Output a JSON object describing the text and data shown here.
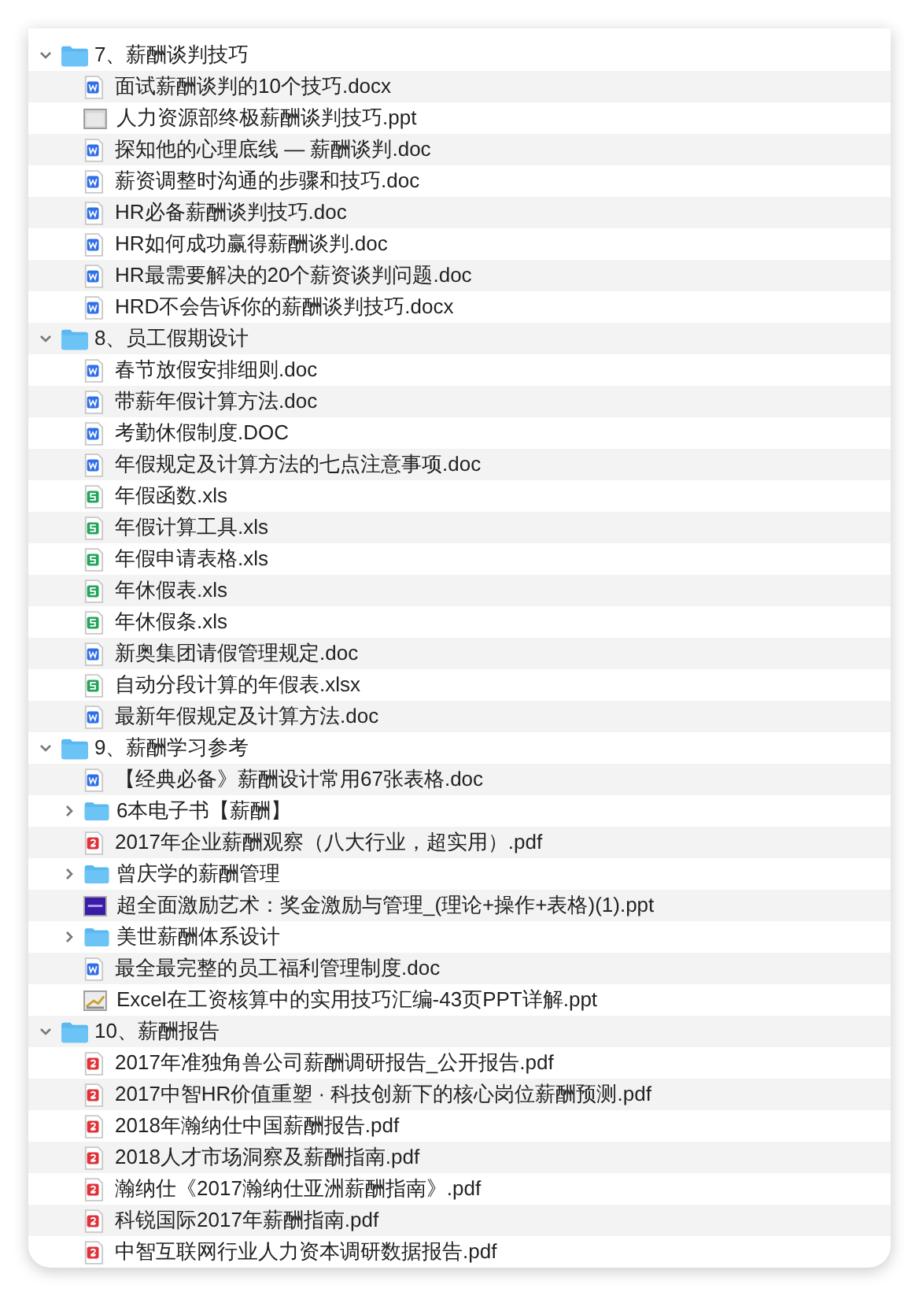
{
  "tree": [
    {
      "label": "7、薪酬谈判技巧",
      "kind": "folder",
      "expanded": true,
      "children": [
        {
          "label": "面试薪酬谈判的10个技巧.docx",
          "kind": "word"
        },
        {
          "label": "人力资源部终极薪酬谈判技巧.ppt",
          "kind": "window"
        },
        {
          "label": "探知他的心理底线 — 薪酬谈判.doc",
          "kind": "word"
        },
        {
          "label": "薪资调整时沟通的步骤和技巧.doc",
          "kind": "word"
        },
        {
          "label": "HR必备薪酬谈判技巧.doc",
          "kind": "word"
        },
        {
          "label": "HR如何成功赢得薪酬谈判.doc",
          "kind": "word"
        },
        {
          "label": "HR最需要解决的20个薪资谈判问题.doc",
          "kind": "word"
        },
        {
          "label": "HRD不会告诉你的薪酬谈判技巧.docx",
          "kind": "word"
        }
      ]
    },
    {
      "label": "8、员工假期设计",
      "kind": "folder",
      "expanded": true,
      "children": [
        {
          "label": "春节放假安排细则.doc",
          "kind": "word"
        },
        {
          "label": "带薪年假计算方法.doc",
          "kind": "word"
        },
        {
          "label": "考勤休假制度.DOC",
          "kind": "word"
        },
        {
          "label": "年假规定及计算方法的七点注意事项.doc",
          "kind": "word"
        },
        {
          "label": "年假函数.xls",
          "kind": "sheet"
        },
        {
          "label": "年假计算工具.xls",
          "kind": "sheet"
        },
        {
          "label": "年假申请表格.xls",
          "kind": "sheet"
        },
        {
          "label": "年休假表.xls",
          "kind": "sheet"
        },
        {
          "label": "年休假条.xls",
          "kind": "sheet"
        },
        {
          "label": "新奥集团请假管理规定.doc",
          "kind": "word"
        },
        {
          "label": "自动分段计算的年假表.xlsx",
          "kind": "sheet"
        },
        {
          "label": "最新年假规定及计算方法.doc",
          "kind": "word"
        }
      ]
    },
    {
      "label": "9、薪酬学习参考",
      "kind": "folder",
      "expanded": true,
      "children": [
        {
          "label": "【经典必备》薪酬设计常用67张表格.doc",
          "kind": "word"
        },
        {
          "label": "6本电子书【薪酬】",
          "kind": "folder",
          "expanded": false
        },
        {
          "label": "2017年企业薪酬观察（八大行业，超实用）.pdf",
          "kind": "pdf"
        },
        {
          "label": "曾庆学的薪酬管理",
          "kind": "folder",
          "expanded": false
        },
        {
          "label": "超全面激励艺术：奖金激励与管理_(理论+操作+表格)(1).ppt",
          "kind": "purple"
        },
        {
          "label": "美世薪酬体系设计",
          "kind": "folder",
          "expanded": false
        },
        {
          "label": "最全最完整的员工福利管理制度.doc",
          "kind": "word"
        },
        {
          "label": "Excel在工资核算中的实用技巧汇编-43页PPT详解.ppt",
          "kind": "chart"
        }
      ]
    },
    {
      "label": "10、薪酬报告",
      "kind": "folder",
      "expanded": true,
      "children": [
        {
          "label": "2017年准独角兽公司薪酬调研报告_公开报告.pdf",
          "kind": "pdf"
        },
        {
          "label": "2017中智HR价值重塑 · 科技创新下的核心岗位薪酬预测.pdf",
          "kind": "pdf"
        },
        {
          "label": "2018年瀚纳仕中国薪酬报告.pdf",
          "kind": "pdf"
        },
        {
          "label": "2018人才市场洞察及薪酬指南.pdf",
          "kind": "pdf"
        },
        {
          "label": "瀚纳仕《2017瀚纳仕亚洲薪酬指南》.pdf",
          "kind": "pdf"
        },
        {
          "label": "科锐国际2017年薪酬指南.pdf",
          "kind": "pdf"
        },
        {
          "label": "中智互联网行业人力资本调研数据报告.pdf",
          "kind": "pdf"
        }
      ]
    }
  ]
}
